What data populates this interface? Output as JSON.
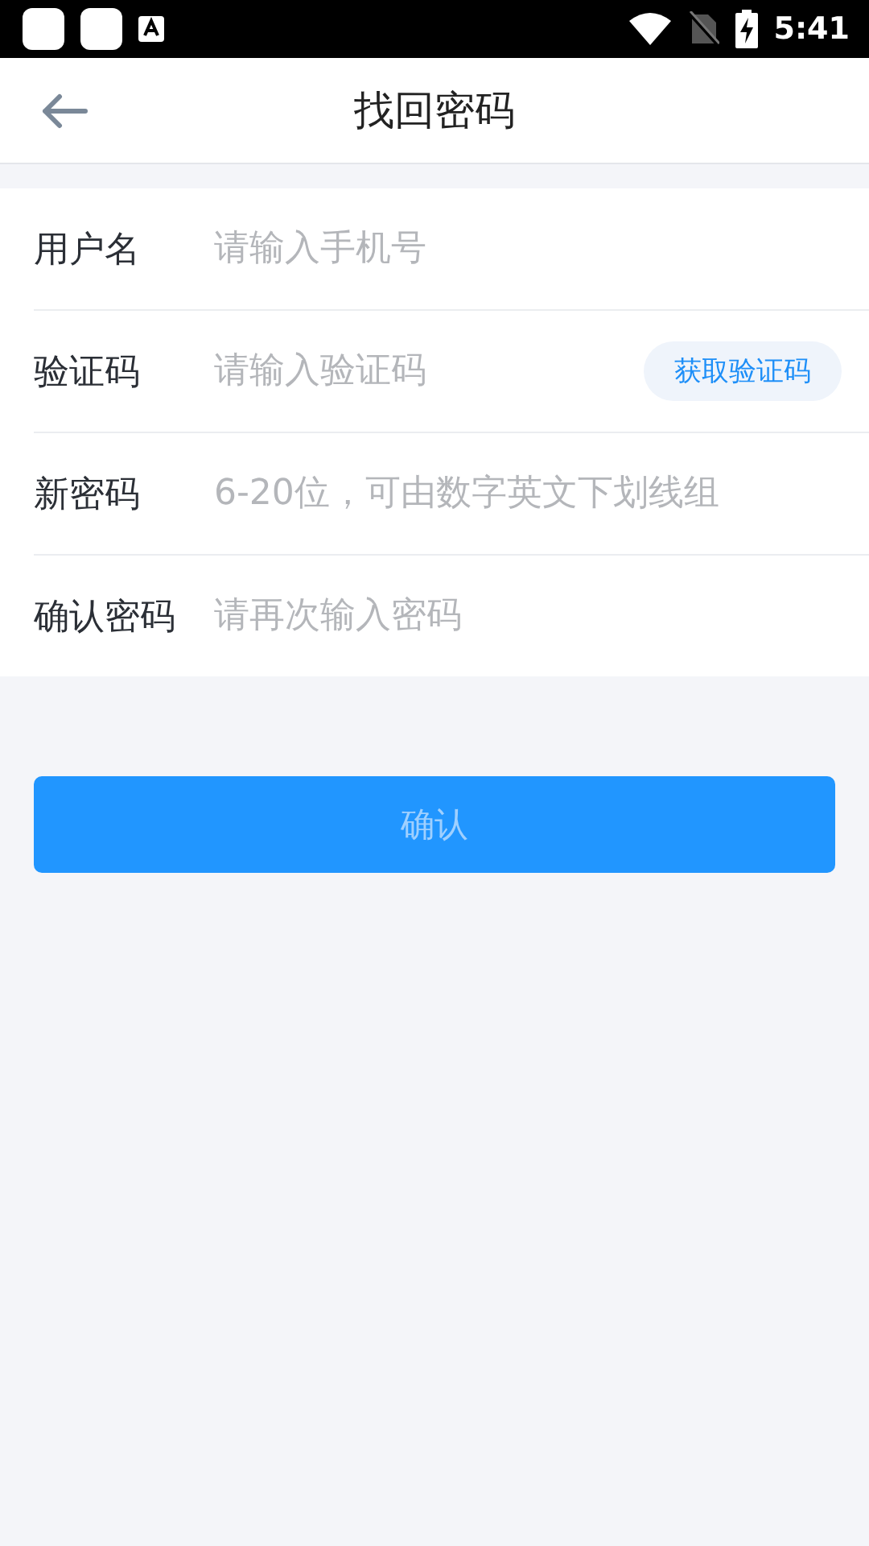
{
  "status_bar": {
    "time": "5:41"
  },
  "header": {
    "title": "找回密码"
  },
  "form": {
    "rows": [
      {
        "label": "用户名",
        "placeholder": "请输入手机号"
      },
      {
        "label": "验证码",
        "placeholder": "请输入验证码",
        "action": "获取验证码"
      },
      {
        "label": "新密码",
        "placeholder": "6-20位，可由数字英文下划线组"
      },
      {
        "label": "确认密码",
        "placeholder": "请再次输入密码"
      }
    ]
  },
  "confirm_button": {
    "label": "确认",
    "disabled": true
  }
}
